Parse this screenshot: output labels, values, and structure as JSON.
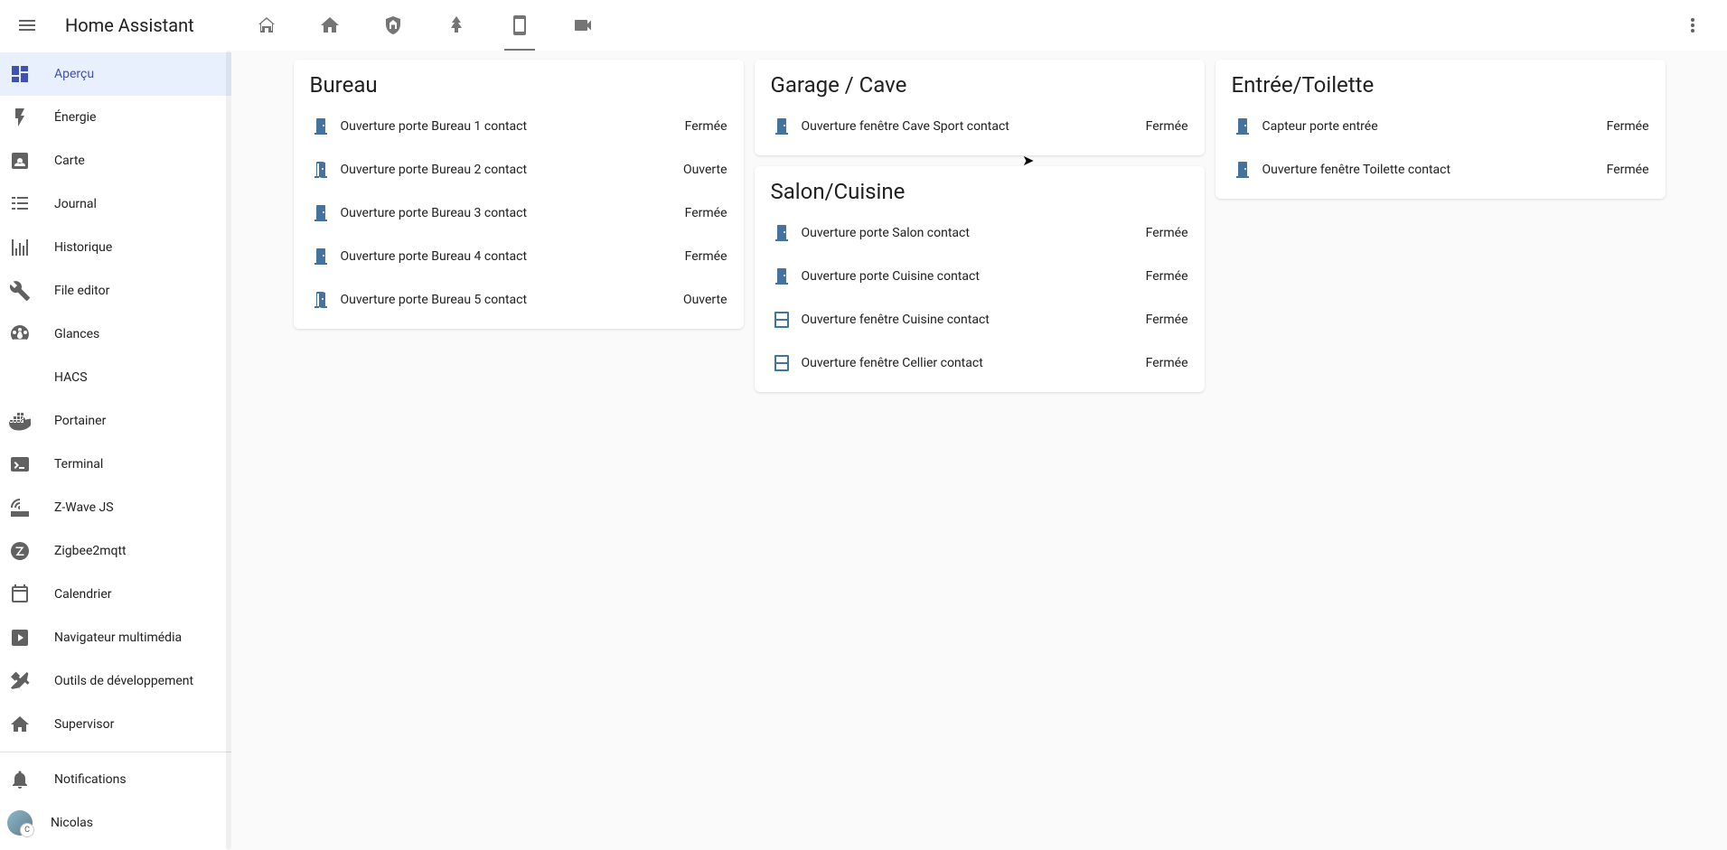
{
  "app_title": "Home Assistant",
  "sidebar": {
    "items": [
      {
        "label": "Aperçu"
      },
      {
        "label": "Énergie"
      },
      {
        "label": "Carte"
      },
      {
        "label": "Journal"
      },
      {
        "label": "Historique"
      },
      {
        "label": "File editor"
      },
      {
        "label": "Glances"
      },
      {
        "label": "HACS"
      },
      {
        "label": "Portainer"
      },
      {
        "label": "Terminal"
      },
      {
        "label": "Z-Wave JS"
      },
      {
        "label": "Zigbee2mqtt"
      },
      {
        "label": "Calendrier"
      },
      {
        "label": "Navigateur multimédia"
      },
      {
        "label": "Outils de développement"
      },
      {
        "label": "Supervisor"
      }
    ],
    "notifications_label": "Notifications",
    "user_label": "Nicolas"
  },
  "cards": {
    "bureau": {
      "title": "Bureau",
      "rows": [
        {
          "name": "Ouverture porte Bureau 1 contact",
          "state": "Fermée",
          "open": false
        },
        {
          "name": "Ouverture porte Bureau 2 contact",
          "state": "Ouverte",
          "open": true
        },
        {
          "name": "Ouverture porte Bureau 3 contact",
          "state": "Fermée",
          "open": false
        },
        {
          "name": "Ouverture porte Bureau 4 contact",
          "state": "Fermée",
          "open": false
        },
        {
          "name": "Ouverture porte Bureau 5 contact",
          "state": "Ouverte",
          "open": true
        }
      ]
    },
    "garage": {
      "title": "Garage / Cave",
      "rows": [
        {
          "name": "Ouverture fenêtre Cave Sport contact",
          "state": "Fermée",
          "icon": "door"
        }
      ]
    },
    "salon": {
      "title": "Salon/Cuisine",
      "rows": [
        {
          "name": "Ouverture porte Salon contact",
          "state": "Fermée",
          "icon": "door"
        },
        {
          "name": "Ouverture porte Cuisine contact",
          "state": "Fermée",
          "icon": "door"
        },
        {
          "name": "Ouverture fenêtre Cuisine contact",
          "state": "Fermée",
          "icon": "window"
        },
        {
          "name": "Ouverture fenêtre Cellier contact",
          "state": "Fermée",
          "icon": "window"
        }
      ]
    },
    "entree": {
      "title": "Entrée/Toilette",
      "rows": [
        {
          "name": "Capteur porte entrée",
          "state": "Fermée",
          "icon": "door"
        },
        {
          "name": "Ouverture fenêtre Toilette contact",
          "state": "Fermée",
          "icon": "door"
        }
      ]
    }
  }
}
